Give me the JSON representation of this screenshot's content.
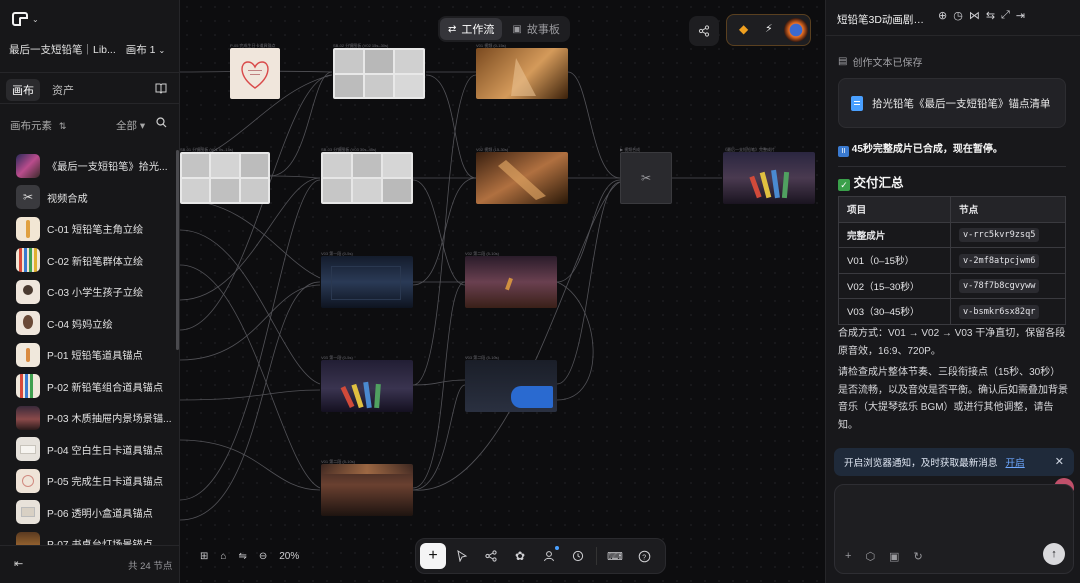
{
  "left": {
    "project_title": "最后一支短铅笔｜Lib...",
    "canvas_name": "画布 1",
    "tabs": [
      "画布",
      "资产"
    ],
    "elements_label": "画布元素",
    "filter_label": "全部",
    "items": [
      {
        "label": "《最后一支短铅笔》拾光..."
      },
      {
        "label": "视频合成"
      },
      {
        "label": "C-01 短铅笔主角立绘"
      },
      {
        "label": "C-02 新铅笔群体立绘"
      },
      {
        "label": "C-03 小学生孩子立绘"
      },
      {
        "label": "C-04 妈妈立绘"
      },
      {
        "label": "P-01 短铅笔道具锚点"
      },
      {
        "label": "P-02 新铅笔组合道具锚点"
      },
      {
        "label": "P-03 木质抽屉内景场景锚..."
      },
      {
        "label": "P-04 空白生日卡道具锚点"
      },
      {
        "label": "P-05 完成生日卡道具锚点"
      },
      {
        "label": "P-06 透明小盒道具锚点"
      },
      {
        "label": "P-07 书桌台灯场景锚点"
      }
    ],
    "node_count": "共 24 节点"
  },
  "canvas": {
    "workflow_label": "工作流",
    "storyboard_label": "故事板",
    "zoom": "20%"
  },
  "right": {
    "title": "短铅笔3D动画剧本...",
    "saved_text": "创作文本已保存",
    "doc_title": "拾光铅笔《最后一支短铅笔》锚点清单",
    "pause_text": "45秒完整成片已合成，现在暂停。",
    "delivery_heading": "交付汇总",
    "table_headers": [
      "项目",
      "节点"
    ],
    "table_rows": [
      {
        "item": "完整成片",
        "node": "v-rrc5kvr9zsq5"
      },
      {
        "item": "V01（0–15秒）",
        "node": "v-2mf8atpcjwm6"
      },
      {
        "item": "V02（15–30秒）",
        "node": "v-78f7b8cgvyww"
      },
      {
        "item": "V03（30–45秒）",
        "node": "v-bsmkr6sx82qr"
      }
    ],
    "compose_text": "合成方式：V01 → V02 → V03 干净直切，保留各段原音效，16:9、720P。",
    "review_text": "请检查成片整体节奏、三段衔接点（15秒、30秒）是否流畅，以及音效是否平衡。确认后如需叠加背景音乐（大提琴弦乐 BGM）或进行其他调整，请告知。",
    "notif_text": "开启浏览器通知，及时获取最新消息",
    "notif_link": "开启"
  },
  "colors": {
    "accent": "#6ea8ff",
    "bg": "#0e0e10",
    "panel": "#18181b"
  }
}
